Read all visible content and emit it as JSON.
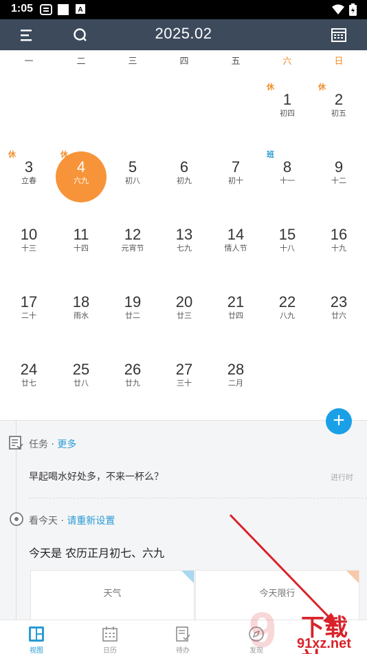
{
  "status_bar": {
    "time": "1:05"
  },
  "app_bar": {
    "title": "2025.02"
  },
  "weekdays": [
    "一",
    "二",
    "三",
    "四",
    "五",
    "六",
    "日"
  ],
  "days": [
    {
      "num": "1",
      "lunar": "初四",
      "badge": "休",
      "badge_type": "rest"
    },
    {
      "num": "2",
      "lunar": "初五",
      "badge": "休",
      "badge_type": "rest"
    },
    {
      "num": "3",
      "lunar": "立春",
      "badge": "休",
      "badge_type": "rest"
    },
    {
      "num": "4",
      "lunar": "六九",
      "badge": "休",
      "badge_type": "rest",
      "today": true
    },
    {
      "num": "5",
      "lunar": "初八"
    },
    {
      "num": "6",
      "lunar": "初九"
    },
    {
      "num": "7",
      "lunar": "初十"
    },
    {
      "num": "8",
      "lunar": "十一",
      "badge": "班",
      "badge_type": "work"
    },
    {
      "num": "9",
      "lunar": "十二"
    },
    {
      "num": "10",
      "lunar": "十三"
    },
    {
      "num": "11",
      "lunar": "十四"
    },
    {
      "num": "12",
      "lunar": "元宵节"
    },
    {
      "num": "13",
      "lunar": "七九"
    },
    {
      "num": "14",
      "lunar": "情人节"
    },
    {
      "num": "15",
      "lunar": "十八"
    },
    {
      "num": "16",
      "lunar": "十九"
    },
    {
      "num": "17",
      "lunar": "二十"
    },
    {
      "num": "18",
      "lunar": "雨水"
    },
    {
      "num": "19",
      "lunar": "廿二"
    },
    {
      "num": "20",
      "lunar": "廿三"
    },
    {
      "num": "21",
      "lunar": "廿四"
    },
    {
      "num": "22",
      "lunar": "八九"
    },
    {
      "num": "23",
      "lunar": "廿六"
    },
    {
      "num": "24",
      "lunar": "廿七"
    },
    {
      "num": "25",
      "lunar": "廿八"
    },
    {
      "num": "26",
      "lunar": "廿九"
    },
    {
      "num": "27",
      "lunar": "三十"
    },
    {
      "num": "28",
      "lunar": "二月"
    }
  ],
  "tasks": {
    "title": "任务 · ",
    "more": "更多",
    "item_text": "早起喝水好处多，不来一杯么？",
    "item_status": "进行时"
  },
  "today_section": {
    "title": "看今天 · ",
    "reset": "请重新设置",
    "text": "今天是 农历正月初七、六九",
    "cards": [
      "天气",
      "今天限行"
    ]
  },
  "fab_label": "+",
  "bottom_nav": [
    {
      "label": "视图",
      "active": true
    },
    {
      "label": "日历"
    },
    {
      "label": "待办"
    },
    {
      "label": "发现"
    }
  ],
  "watermark": {
    "cn": "下载站",
    "en": "91xz.net"
  },
  "colors": {
    "app_bar": "#3c4a5c",
    "today": "#f7943a",
    "accent": "#2a9bd4",
    "rest": "#f08c28"
  }
}
